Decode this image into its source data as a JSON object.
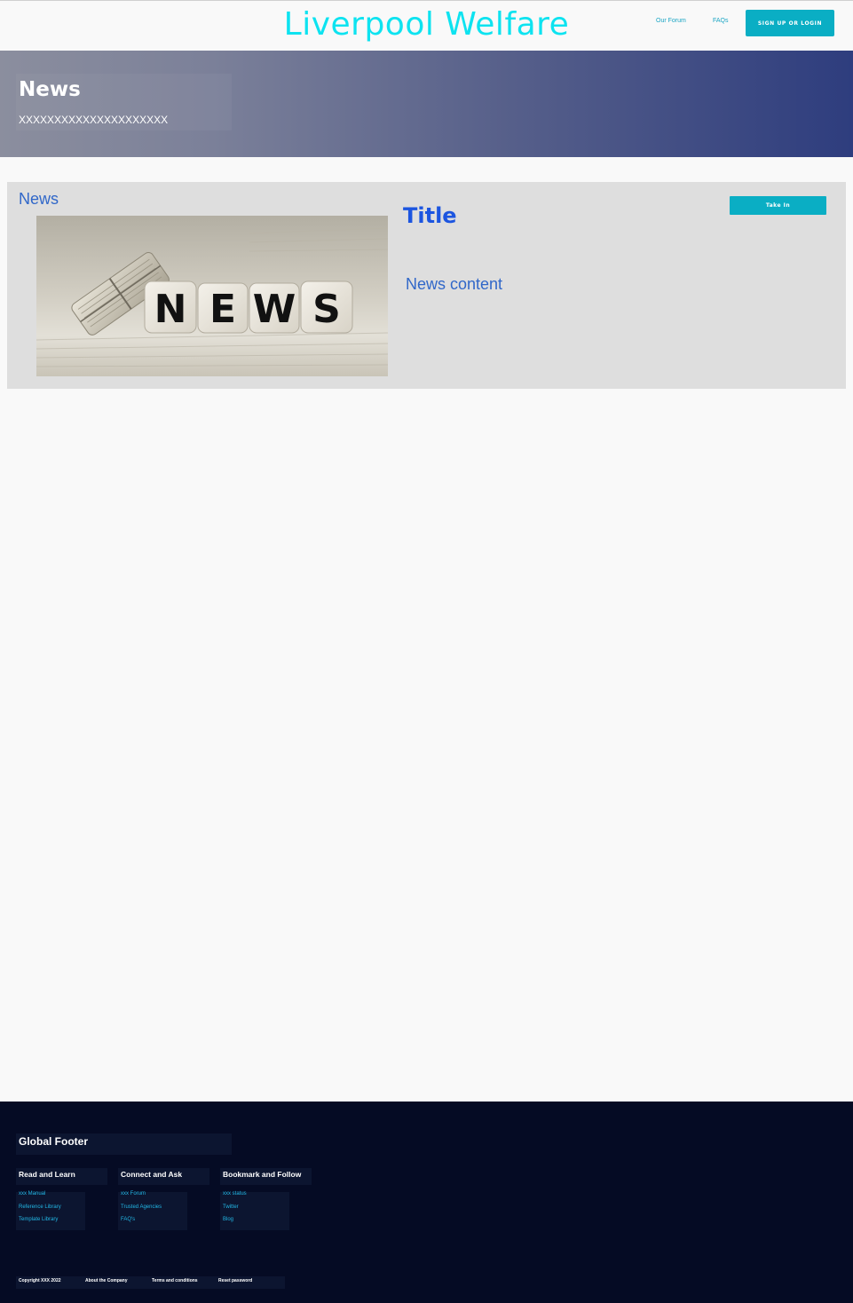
{
  "header": {
    "site_title": "Liverpool Welfare",
    "nav": {
      "forum": "Our Forum",
      "faqs": "FAQs"
    },
    "signup_button": "SIGN UP OR LOGIN"
  },
  "banner": {
    "title": "News",
    "subtitle": "XXXXXXXXXXXXXXXXXXXXX",
    "gradient_start": "#8b8e9e",
    "gradient_end": "#2e3d7e"
  },
  "news_card": {
    "section_label": "News",
    "image_letters": [
      "N",
      "E",
      "W",
      "S"
    ],
    "title": "Title",
    "content": "News content",
    "action_button": "Take In"
  },
  "footer": {
    "title": "Global Footer",
    "columns": [
      {
        "heading": "Read and Learn",
        "links": [
          "xxx Manual",
          "Reference Library",
          "Template Library"
        ]
      },
      {
        "heading": "Connect and Ask",
        "links": [
          "xxx Forum",
          "Trusted Agencies",
          "FAQ's"
        ]
      },
      {
        "heading": "Bookmark and Follow",
        "links": [
          "xxx status",
          "Twitter",
          "Blog"
        ]
      }
    ],
    "copyright": "Copyright XXX 2022",
    "legal_links": [
      "About the Company",
      "Terms and conditions",
      "Reset password"
    ]
  },
  "colors": {
    "accent": "#0aaec4",
    "title_cyan": "#0de3f0",
    "link_blue": "#3067c9",
    "footer_bg": "#050b24"
  }
}
